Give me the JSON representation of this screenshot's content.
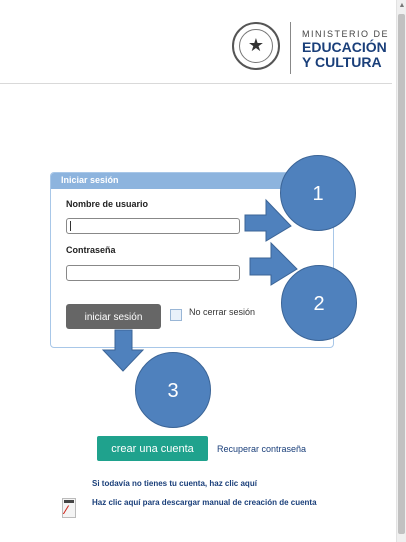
{
  "header": {
    "logo_small": "MINISTERIO DE",
    "logo_line1": "EDUCACIÓN",
    "logo_line2": "Y CULTURA",
    "seal_icon": "seal-icon"
  },
  "login": {
    "panel_title": "Iniciar sesión",
    "username_label": "Nombre de usuario",
    "username_value": "",
    "password_label": "Contraseña",
    "password_value": "",
    "submit_label": "iniciar sesión",
    "remember_label": "No cerrar sesión",
    "remember_checked": false
  },
  "callouts": [
    "1",
    "2",
    "3"
  ],
  "links": {
    "create_account": "crear una cuenta",
    "recover_password": "Recuperar contraseña",
    "signup_hint": "Si todavía no tienes tu cuenta, haz clic aquí",
    "manual_download": "Haz clic aquí para descargar manual de creación de cuenta"
  },
  "colors": {
    "accent": "#1fa28d",
    "panel_header": "#8db4de",
    "callout": "#4f81bd",
    "link": "#1a3f7a"
  }
}
